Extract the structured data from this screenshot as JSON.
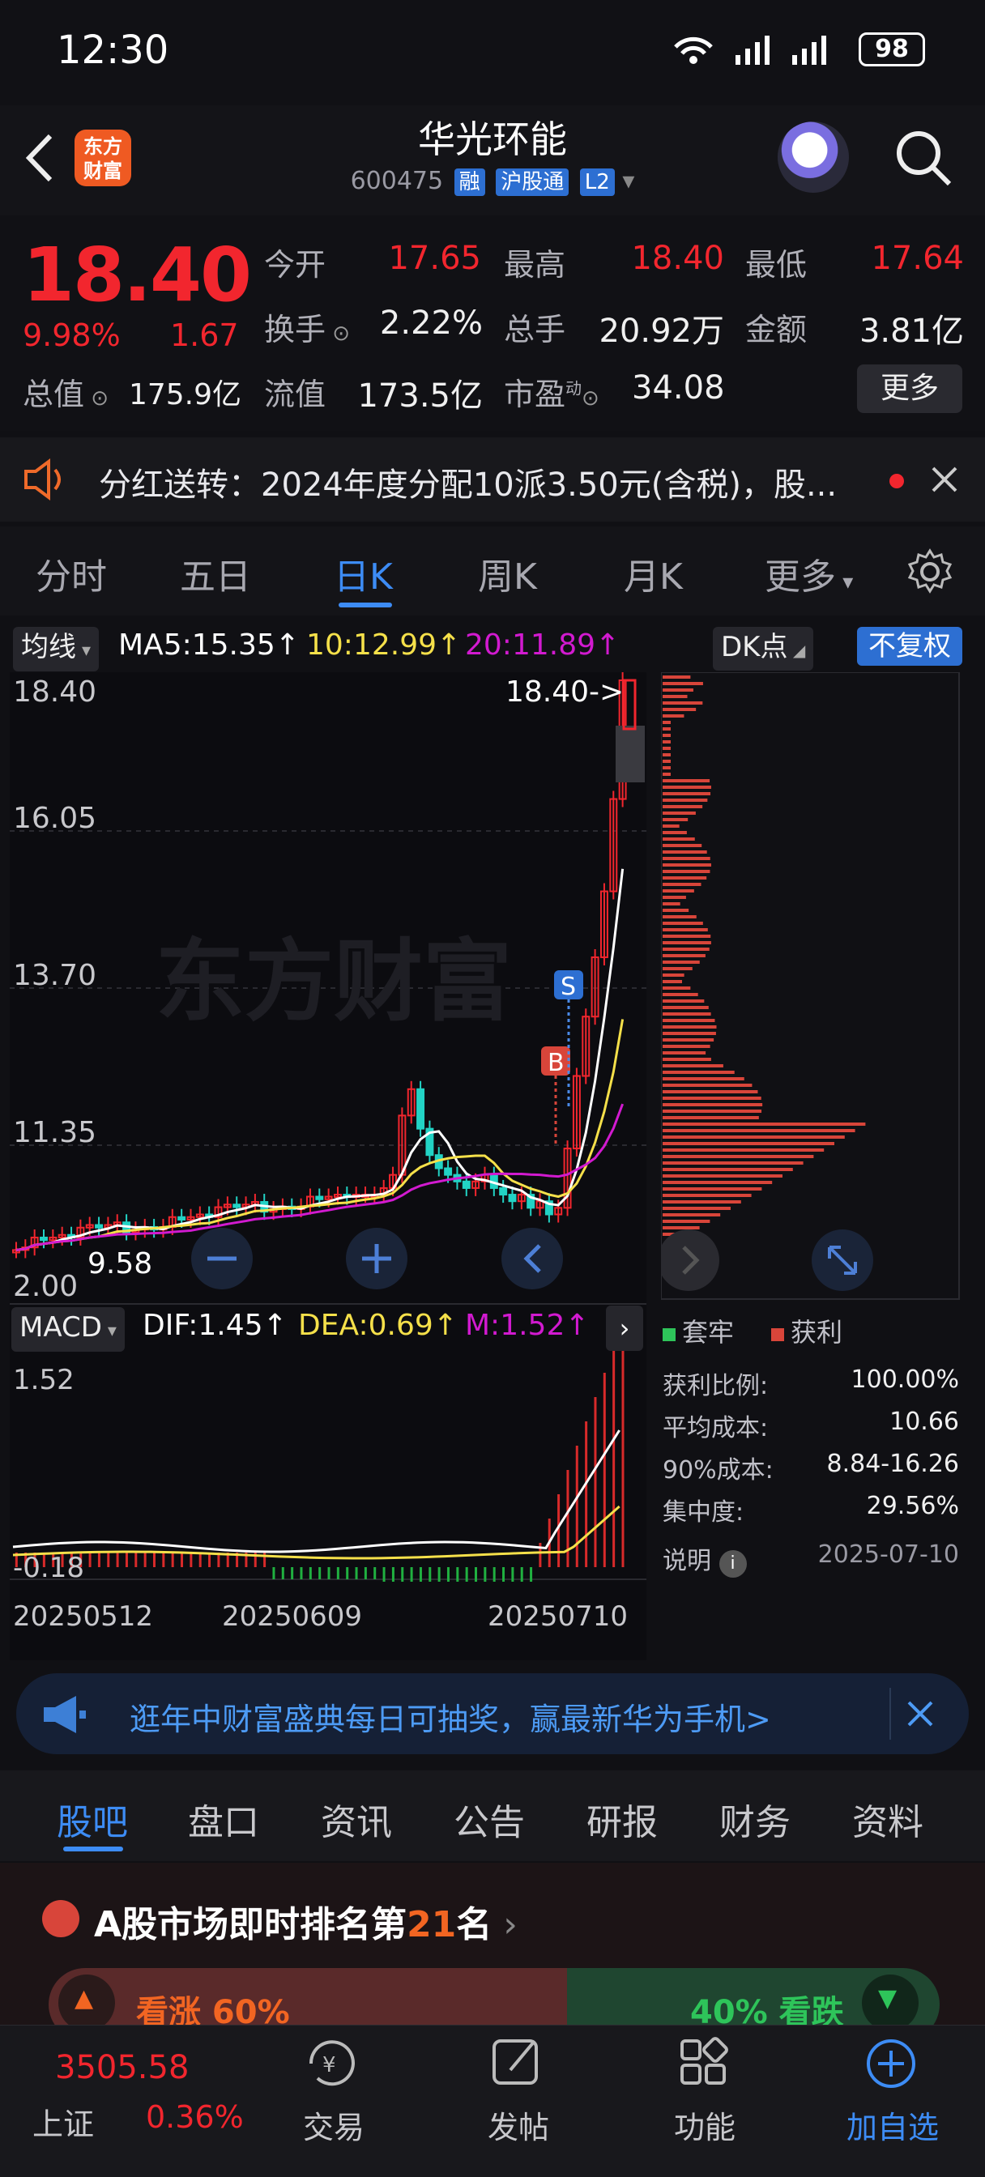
{
  "status_bar": {
    "time": "12:30",
    "battery": "98"
  },
  "header": {
    "title": "华光环能",
    "code": "600475",
    "tags": [
      "融",
      "沪股通",
      "L2"
    ],
    "logo_text": [
      "东方",
      "财富"
    ]
  },
  "quote": {
    "price": "18.40",
    "pct": "9.98%",
    "change": "1.67",
    "fields": [
      {
        "label": "今开",
        "value": "17.65",
        "color": "red"
      },
      {
        "label": "最高",
        "value": "18.40",
        "color": "red"
      },
      {
        "label": "最低",
        "value": "17.64",
        "color": "red"
      },
      {
        "label": "换手",
        "value": "2.22%",
        "color": "white"
      },
      {
        "label": "总手",
        "value": "20.92万",
        "color": "white"
      },
      {
        "label": "金额",
        "value": "3.81亿",
        "color": "white"
      },
      {
        "label": "总值",
        "value": "175.9亿",
        "color": "white"
      },
      {
        "label": "流值",
        "value": "173.5亿",
        "color": "white"
      },
      {
        "label": "市盈",
        "value": "34.08",
        "color": "white"
      }
    ],
    "pe_superscript": "动",
    "more_label": "更多"
  },
  "notice": {
    "text": "分红送转：2024年度分配10派3.50元(含税)，股..."
  },
  "period_tabs": [
    "分时",
    "五日",
    "日K",
    "周K",
    "月K",
    "更多"
  ],
  "indicators": {
    "ma_selector": "均线",
    "ma5": "MA5:15.35↑",
    "ma10": "10:12.99↑",
    "ma20": "20:11.89↑",
    "dk_label": "DK点",
    "adjust_label": "不复权",
    "macd_selector": "MACD",
    "dif": "DIF:1.45↑",
    "dea": "DEA:0.69↑",
    "m": "M:1.52↑"
  },
  "kline": {
    "y_labels": [
      "18.40",
      "16.05",
      "13.70",
      "11.35",
      "2.00"
    ],
    "last_price_label": "18.40->",
    "low_label": "9.58",
    "watermark": "东方财富",
    "buy_marker": "B",
    "sell_marker": "S",
    "macd_labels": [
      "1.52",
      "-0.18"
    ],
    "dates": [
      "20250512",
      "20250609",
      "20250710"
    ]
  },
  "chips": {
    "legend": [
      "套牢",
      "获利"
    ],
    "rows": [
      {
        "label": "获利比例:",
        "value": "100.00%"
      },
      {
        "label": "平均成本:",
        "value": "10.66"
      },
      {
        "label": "90%成本:",
        "value": "8.84-16.26"
      },
      {
        "label": "集中度:",
        "value": "29.56%"
      },
      {
        "label": "说明",
        "value": "2025-07-10"
      }
    ]
  },
  "chart_data": {
    "type": "table",
    "title": "",
    "price_axis": [
      18.4,
      16.05,
      13.7,
      11.35
    ],
    "ma": {
      "ma5": 15.35,
      "ma10": 12.99,
      "ma20": 11.89
    },
    "macd": {
      "dif": 1.45,
      "dea": 0.69,
      "m": 1.52,
      "axis_top": 1.52,
      "axis_bottom": -0.18
    },
    "dates": [
      "20250512",
      "20250609",
      "20250710"
    ]
  },
  "ad": {
    "text": "逛年中财富盛典每日可抽奖，赢最新华为手机>"
  },
  "info_tabs": [
    "股吧",
    "盘口",
    "资讯",
    "公告",
    "研报",
    "财务",
    "资料"
  ],
  "rank": {
    "prefix": "A股市场即时排名第",
    "num": "21",
    "suffix": "名",
    "up": "看涨 60%",
    "down": "40% 看跌"
  },
  "bottom_nav": {
    "index_value": "3505.58",
    "index_name": "上证",
    "index_pct": "0.36%",
    "items": [
      "交易",
      "发帖",
      "功能",
      "加自选"
    ]
  },
  "colors": {
    "up": "#f2262e",
    "down": "#2ec45a",
    "accent": "#3d8cf5",
    "ma5": "#ffffff",
    "ma10": "#f5e04a",
    "ma20": "#d21ad0"
  }
}
